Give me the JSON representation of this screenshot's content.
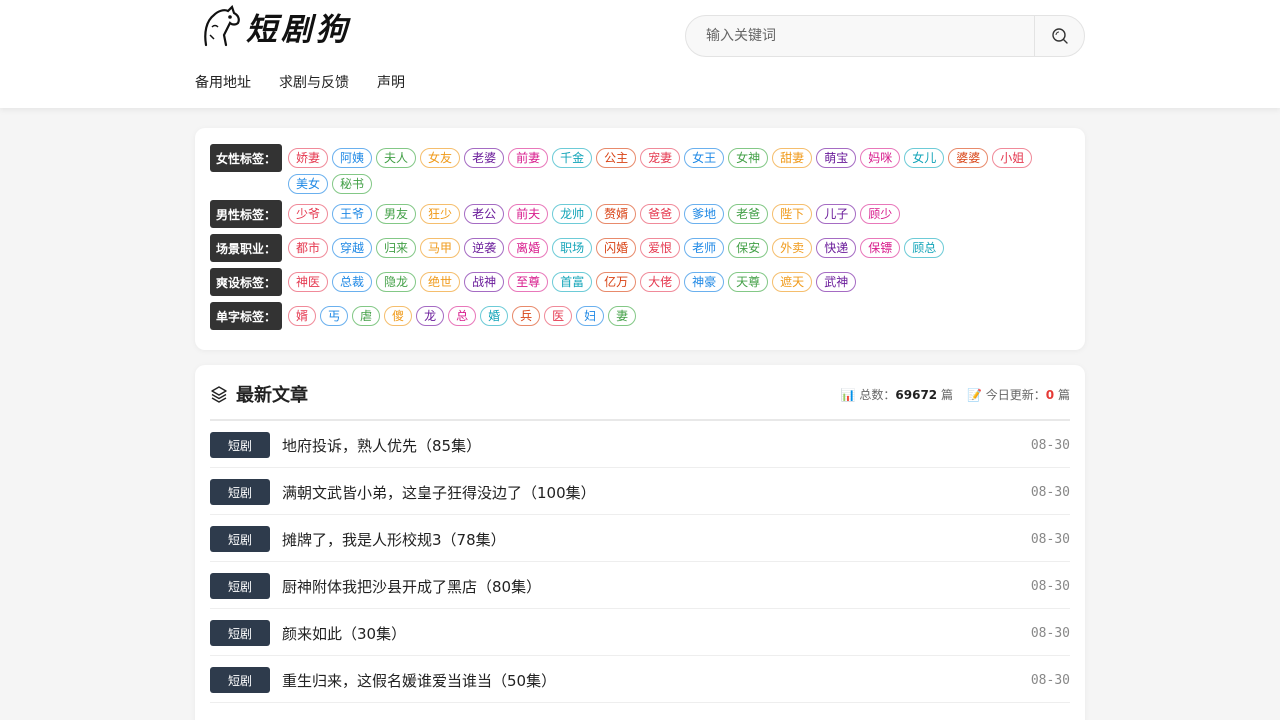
{
  "site": {
    "logo_text": "短剧狗"
  },
  "search": {
    "placeholder": "输入关键词"
  },
  "nav": [
    {
      "label": "备用地址"
    },
    {
      "label": "求剧与反馈"
    },
    {
      "label": "声明"
    }
  ],
  "tag_groups": [
    {
      "label": "女性标签：",
      "tags": [
        "娇妻",
        "阿姨",
        "夫人",
        "女友",
        "老婆",
        "前妻",
        "千金",
        "公主",
        "宠妻",
        "女王",
        "女神",
        "甜妻",
        "萌宝",
        "妈咪",
        "女儿",
        "婆婆",
        "小姐",
        "美女",
        "秘书"
      ]
    },
    {
      "label": "男性标签：",
      "tags": [
        "少爷",
        "王爷",
        "男友",
        "狂少",
        "老公",
        "前夫",
        "龙帅",
        "赘婿",
        "爸爸",
        "爹地",
        "老爸",
        "陛下",
        "儿子",
        "顾少"
      ]
    },
    {
      "label": "场景职业：",
      "tags": [
        "都市",
        "穿越",
        "归来",
        "马甲",
        "逆袭",
        "离婚",
        "职场",
        "闪婚",
        "爱恨",
        "老师",
        "保安",
        "外卖",
        "快递",
        "保镖",
        "顾总"
      ]
    },
    {
      "label": "爽设标签：",
      "tags": [
        "神医",
        "总裁",
        "隐龙",
        "绝世",
        "战神",
        "至尊",
        "首富",
        "亿万",
        "大佬",
        "神豪",
        "天尊",
        "遮天",
        "武神"
      ]
    },
    {
      "label": "单字标签：",
      "tags": [
        "婿",
        "丐",
        "虐",
        "傻",
        "龙",
        "总",
        "婚",
        "兵",
        "医",
        "妇",
        "妻"
      ]
    }
  ],
  "tag_colors": [
    "#e53950",
    "#1e88e5",
    "#43a047",
    "#f09a1a",
    "#6a1b9a",
    "#d81b8c",
    "#12a4b8",
    "#d84315"
  ],
  "articles": {
    "title": "最新文章",
    "total_label": "总数：",
    "total": "69672",
    "unit": "篇",
    "today_label": "今日更新：",
    "today": "0",
    "items": [
      {
        "category": "短剧",
        "title": "地府投诉，熟人优先（85集）",
        "date": "08-30"
      },
      {
        "category": "短剧",
        "title": "满朝文武皆小弟，这皇子狂得没边了（100集）",
        "date": "08-30"
      },
      {
        "category": "短剧",
        "title": "摊牌了，我是人形校规3（78集）",
        "date": "08-30"
      },
      {
        "category": "短剧",
        "title": "厨神附体我把沙县开成了黑店（80集）",
        "date": "08-30"
      },
      {
        "category": "短剧",
        "title": "颜来如此（30集）",
        "date": "08-30"
      },
      {
        "category": "短剧",
        "title": "重生归来，这假名媛谁爱当谁当（50集）",
        "date": "08-30"
      }
    ]
  }
}
